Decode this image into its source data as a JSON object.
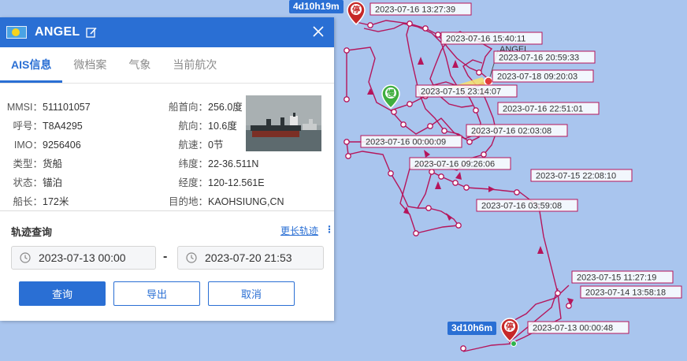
{
  "vessel": {
    "name": "ANGEL",
    "flag_colors": {
      "field": "#4aa3e4",
      "disc": "#f6d31e"
    }
  },
  "tabs": [
    {
      "label": "AIS信息",
      "active": true
    },
    {
      "label": "微档案",
      "active": false
    },
    {
      "label": "气象",
      "active": false
    },
    {
      "label": "当前航次",
      "active": false
    }
  ],
  "ais": {
    "mmsi": {
      "label": "MMSI：",
      "value": "511101057"
    },
    "callsign": {
      "label": "呼号：",
      "value": "T8A4295"
    },
    "imo": {
      "label": "IMO：",
      "value": "9256406"
    },
    "type": {
      "label": "类型：",
      "value": "货船"
    },
    "status": {
      "label": "状态：",
      "value": "锚泊"
    },
    "length": {
      "label": "船长：",
      "value": "172米"
    },
    "heading": {
      "label": "船首向：",
      "value": "256.0度"
    },
    "course": {
      "label": "航向：",
      "value": "10.6度"
    },
    "speed": {
      "label": "航速：",
      "value": "0节"
    },
    "lat": {
      "label": "纬度：",
      "value": "22-36.511N"
    },
    "lon": {
      "label": "经度：",
      "value": "120-12.561E"
    },
    "dest": {
      "label": "目的地：",
      "value": "KAOHSIUNG,CN"
    }
  },
  "track": {
    "title": "轨迹查询",
    "more_link": "更长轨迹",
    "more_icon": "⋮",
    "start": "2023-07-13 00:00",
    "sep": "-",
    "end": "2023-07-20 21:53",
    "buttons": {
      "query": "查询",
      "export": "导出",
      "cancel": "取消"
    }
  },
  "map": {
    "track_color": "#b5155b",
    "stop_pin_text": "停",
    "slow_pin_text": "慢",
    "duration_top": "4d10h19m",
    "duration_bottom": "3d10h6m",
    "ship_label": "ANGEL",
    "timestamps": [
      "2023-07-16 13:27:39",
      "2023-07-16 15:40:11",
      "2023-07-16 20:59:33",
      "2023-07-18 09:20:03",
      "2023-07-15 23:14:07",
      "2023-07-16 22:51:01",
      "2023-07-16 02:03:08",
      "2023-07-16 00:00:09",
      "2023-07-16 09:26:06",
      "2023-07-15 22:08:10",
      "2023-07-16 03:59:08",
      "2023-07-15 11:27:19",
      "2023-07-14 13:58:18",
      "2023-07-13 00:00:48"
    ]
  }
}
